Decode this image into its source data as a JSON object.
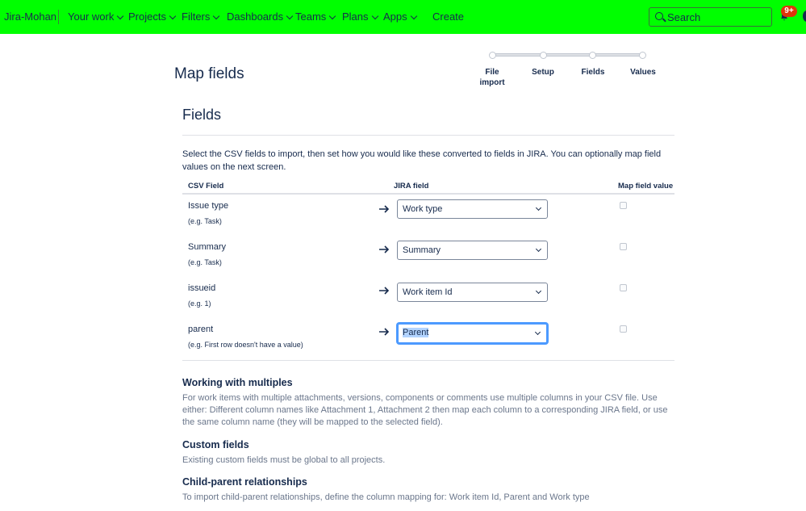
{
  "topnav": {
    "brand": "Jira-Mohan",
    "items": [
      {
        "label": "Your work",
        "has_chevron": true
      },
      {
        "label": "Projects",
        "has_chevron": true
      },
      {
        "label": "Filters",
        "has_chevron": true
      },
      {
        "label": "Dashboards",
        "has_chevron": true
      },
      {
        "label": "Teams",
        "has_chevron": true
      },
      {
        "label": "Plans",
        "has_chevron": true
      },
      {
        "label": "Apps",
        "has_chevron": true
      }
    ],
    "create_label": "Create",
    "search_placeholder": "Search",
    "notifications_badge": "9+",
    "bg_color": "#00ff00",
    "badge_color": "#de350b"
  },
  "page": {
    "title": "Map fields"
  },
  "tracker": {
    "steps": [
      "File import",
      "Setup",
      "Fields",
      "Values"
    ]
  },
  "fields_section": {
    "title": "Fields",
    "intro": "Select the CSV fields to import, then set how you would like these converted to fields in JIRA. You can optionally map field values on the next screen.",
    "headers": {
      "csv_field": "CSV Field",
      "jira_field": "JIRA field",
      "map_value": "Map field value"
    },
    "rows": [
      {
        "name": "Issue type",
        "example": "(e.g. Task)",
        "jira_field": "Work type",
        "map_value": false,
        "focused": false
      },
      {
        "name": "Summary",
        "example": "(e.g. Task)",
        "jira_field": "Summary",
        "map_value": false,
        "focused": false
      },
      {
        "name": "issueid",
        "example": "(e.g. 1)",
        "jira_field": "Work item Id",
        "map_value": false,
        "focused": false
      },
      {
        "name": "parent",
        "example": "(e.g. First row doesn't have a value)",
        "jira_field": "Parent",
        "map_value": false,
        "focused": true
      }
    ]
  },
  "help": {
    "multiples": {
      "title": "Working with multiples",
      "text": "For work items with multiple attachments, versions, components or comments use multiple columns in your CSV file. Use either: Different column names like Attachment 1, Attachment 2 then map each column to a corresponding JIRA field, or use the same column name (they will be mapped to the selected field)."
    },
    "custom": {
      "title": "Custom fields",
      "text": "Existing custom fields must be global to all projects."
    },
    "child_parent": {
      "title": "Child-parent relationships",
      "text": "To import child-parent relationships, define the column mapping for: Work item Id, Parent and Work type"
    }
  }
}
